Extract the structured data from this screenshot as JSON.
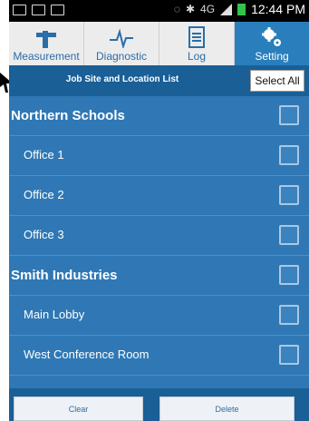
{
  "status_bar": {
    "time": "12:44 PM",
    "network": "4G",
    "icons": [
      "gallery-icon",
      "message-icon",
      "message-icon",
      "vibrate-icon",
      "bluetooth-icon",
      "signal-icon",
      "battery-icon"
    ],
    "battery_color": "#35c24b"
  },
  "tabs": [
    {
      "label": "Measurement",
      "icon": "measurement-icon",
      "active": false
    },
    {
      "label": "Diagnostic",
      "icon": "pulse-icon",
      "active": false
    },
    {
      "label": "Log",
      "icon": "document-icon",
      "active": false
    },
    {
      "label": "Setting",
      "icon": "gears-icon",
      "active": true
    }
  ],
  "header": {
    "title": "Job Site and Location List",
    "select_all": "Select All"
  },
  "list": [
    {
      "type": "group",
      "label": "Northern Schools",
      "checked": false
    },
    {
      "type": "item",
      "label": "Office 1",
      "checked": false
    },
    {
      "type": "item",
      "label": "Office 2",
      "checked": false
    },
    {
      "type": "item",
      "label": "Office 3",
      "checked": false
    },
    {
      "type": "group",
      "label": "Smith Industries",
      "checked": false
    },
    {
      "type": "item",
      "label": "Main Lobby",
      "checked": false
    },
    {
      "type": "item",
      "label": "West Conference Room",
      "checked": false
    }
  ],
  "footer": {
    "clear": "Clear",
    "delete": "Delete"
  },
  "colors": {
    "list_bg": "#2f78b5",
    "header_bg": "#1a5f96",
    "active_tab": "#2a7ebc"
  }
}
